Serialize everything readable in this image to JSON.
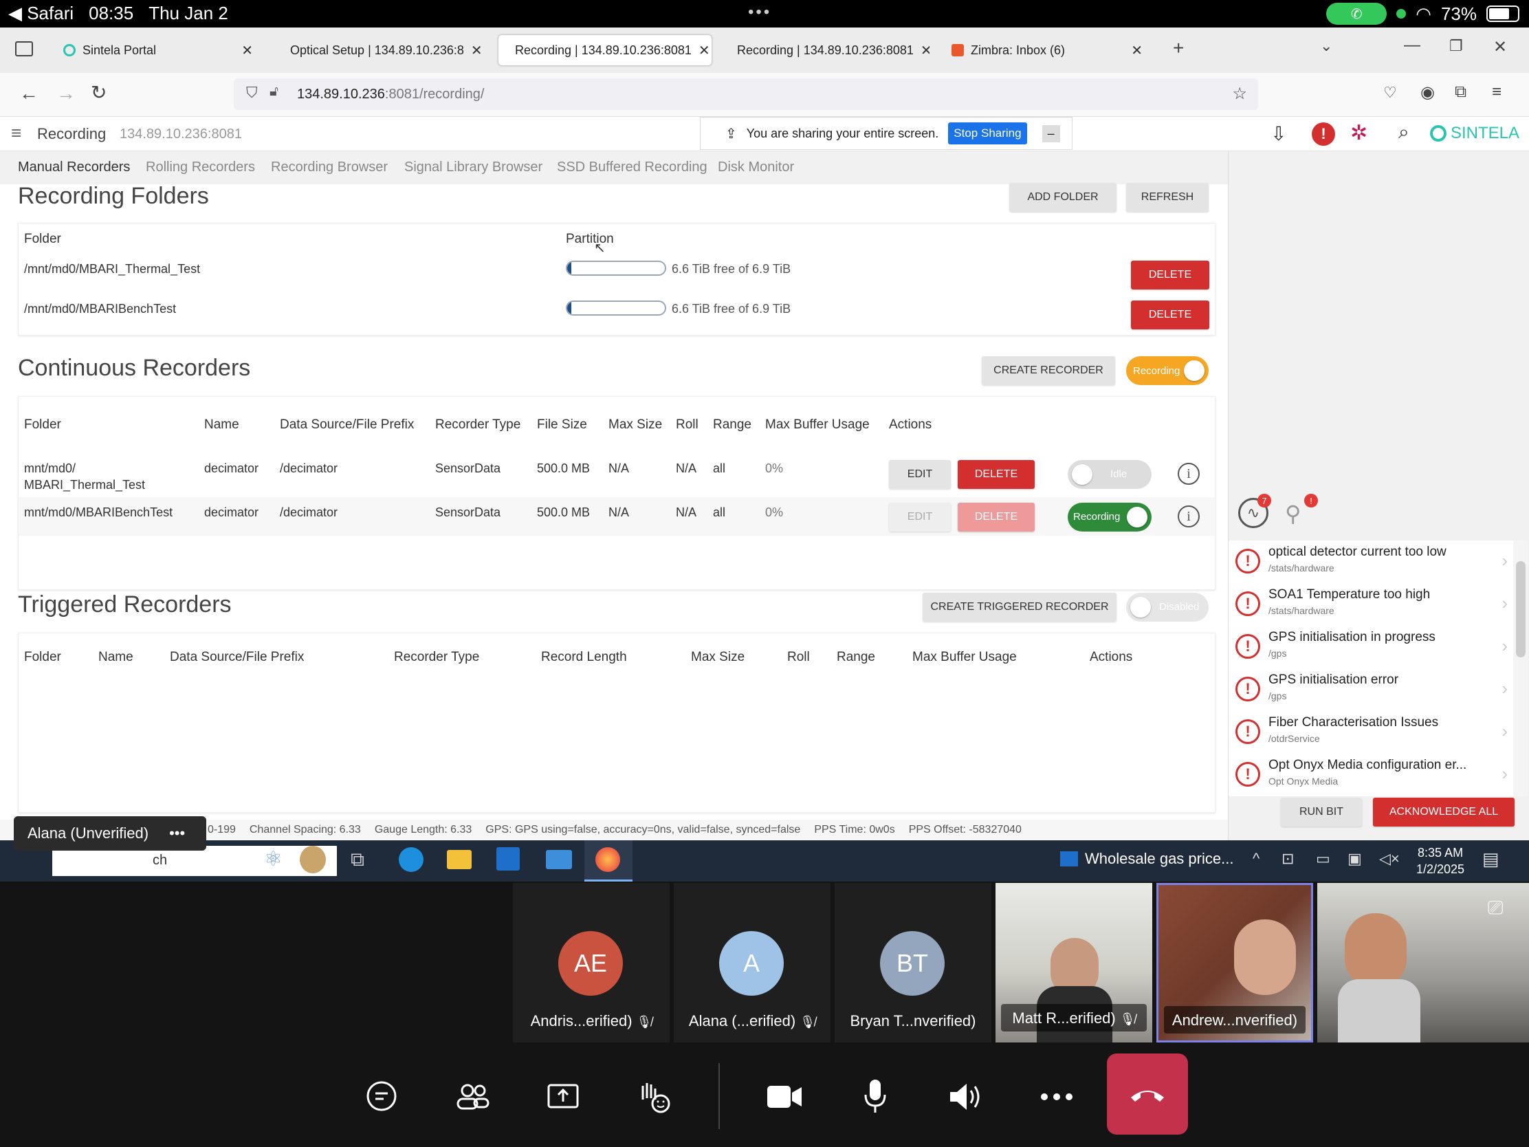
{
  "ipad": {
    "app": "Safari",
    "time": "08:35",
    "date": "Thu Jan 2",
    "battery": "73%"
  },
  "browser": {
    "tabs": [
      {
        "label": "Sintela Portal"
      },
      {
        "label": "Optical Setup | 134.89.10.236:8"
      },
      {
        "label": "Recording | 134.89.10.236:8081"
      },
      {
        "label": "Recording | 134.89.10.236:8081"
      },
      {
        "label": "Zimbra: Inbox (6)"
      }
    ],
    "url_host": "134.89.10.236",
    "url_path": ":8081/recording/"
  },
  "app": {
    "title": "Recording",
    "host": "134.89.10.236:8081",
    "brand": "SINTELA",
    "share_text": "You are sharing your entire screen.",
    "stop_sharing": "Stop Sharing",
    "tabs": [
      "Manual Recorders",
      "Rolling Recorders",
      "Recording Browser",
      "Signal Library Browser",
      "SSD Buffered Recording",
      "Disk Monitor"
    ]
  },
  "folders": {
    "title": "Recording Folders",
    "add_label": "ADD FOLDER",
    "refresh_label": "REFRESH",
    "col_folder": "Folder",
    "col_partition": "Partition",
    "delete_label": "DELETE",
    "rows": [
      {
        "path": "/mnt/md0/MBARI_Thermal_Test",
        "space": "6.6 TiB free of 6.9 TiB",
        "used_fraction": 0.04
      },
      {
        "path": "/mnt/md0/MBARIBenchTest",
        "space": "6.6 TiB free of 6.9 TiB",
        "used_fraction": 0.04
      }
    ]
  },
  "continuous": {
    "title": "Continuous Recorders",
    "create_label": "CREATE RECORDER",
    "master_toggle": "Recording",
    "headers": [
      "Folder",
      "Name",
      "Data Source/File Prefix",
      "Recorder Type",
      "File Size",
      "Max Size",
      "Roll",
      "Range",
      "Max Buffer Usage",
      "Actions"
    ],
    "edit_label": "EDIT",
    "delete_label": "DELETE",
    "rows": [
      {
        "folder1": "mnt/md0/",
        "folder2": "MBARI_Thermal_Test",
        "name": "decimator",
        "source": "/decimator",
        "type": "SensorData",
        "file_size": "500.0 MB",
        "max_size": "N/A",
        "roll": "N/A",
        "range": "all",
        "buffer": "0%",
        "state": "Idle"
      },
      {
        "folder1": "mnt/md0/MBARIBenchTest",
        "folder2": "",
        "name": "decimator",
        "source": "/decimator",
        "type": "SensorData",
        "file_size": "500.0 MB",
        "max_size": "N/A",
        "roll": "N/A",
        "range": "all",
        "buffer": "0%",
        "state": "Recording"
      }
    ]
  },
  "triggered": {
    "title": "Triggered Recorders",
    "create_label": "CREATE TRIGGERED RECORDER",
    "toggle": "Disabled",
    "headers": [
      "Folder",
      "Name",
      "Data Source/File Prefix",
      "Recorder Type",
      "Record Length",
      "Max Size",
      "Roll",
      "Range",
      "Max Buffer Usage",
      "Actions"
    ]
  },
  "alerts": {
    "badge1": "7",
    "badge2": "!",
    "items": [
      {
        "title": "optical detector current too low",
        "path": "/stats/hardware"
      },
      {
        "title": "SOA1 Temperature too high",
        "path": "/stats/hardware"
      },
      {
        "title": "GPS initialisation in progress",
        "path": "/gps"
      },
      {
        "title": "GPS initialisation error",
        "path": "/gps"
      },
      {
        "title": "Fiber Characterisation Issues",
        "path": "/otdrService"
      },
      {
        "title": "Opt Onyx Media configuration er...",
        "path": "Opt Onyx Media"
      }
    ],
    "run_bit": "RUN BIT",
    "ack_all": "ACKNOWLEDGE ALL"
  },
  "statusbar": {
    "s1": "0-199",
    "s2": "Channel Spacing: 6.33",
    "s3": "Gauge Length: 6.33",
    "s4": "GPS: GPS using=false, accuracy=0ns, valid=false, synced=false",
    "s5": "PPS Time: 0w0s",
    "s6": "PPS Offset: -58327040"
  },
  "taskbar": {
    "search_partial": "ch",
    "news": "Wholesale gas price...",
    "time": "8:35 AM",
    "date": "1/2/2025"
  },
  "presenter": "Alana (Unverified)",
  "participants": [
    {
      "initials": "AE",
      "name": "Andris...erified)",
      "color": "#c9533f"
    },
    {
      "initials": "A",
      "name": "Alana (...erified)",
      "color": "#9fc3e6"
    },
    {
      "initials": "BT",
      "name": "Bryan T...nverified)",
      "color": "#93a6bd"
    },
    {
      "initials": "",
      "name": "Matt R...erified)"
    },
    {
      "initials": "",
      "name": "Andrew...nverified)"
    }
  ]
}
